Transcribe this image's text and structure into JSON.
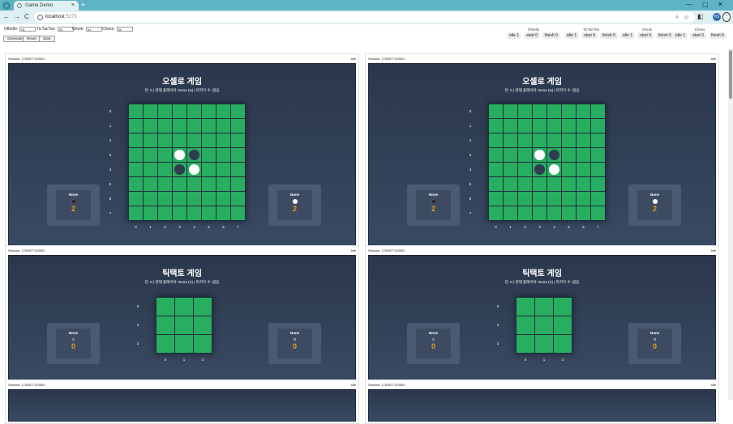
{
  "browser": {
    "tab_title": "Game Demo",
    "url_host": "localhost",
    "url_port": ":5173",
    "new_tab": "+",
    "tab_close": "×",
    "back": "←",
    "forward": "→",
    "reload": "C",
    "zoom_icon": "⌕",
    "star_icon": "☆",
    "menu": "⋮",
    "avatar": "HJ",
    "min": "—",
    "max": "▢",
    "close": "✕",
    "ext1": "◧",
    "ext2": "⇩"
  },
  "controls": {
    "inputs": [
      {
        "label": "Othello:",
        "value": "01"
      },
      {
        "label": "TicTacToe:",
        "value": "01"
      },
      {
        "label": "Omok:",
        "value": "01"
      },
      {
        "label": "Chess:",
        "value": "01"
      }
    ],
    "buttons": [
      "Generate",
      "Reset",
      "Start"
    ]
  },
  "stats": [
    {
      "label": "Othello",
      "chips": [
        "idle 1",
        "start 0",
        "finish 0"
      ]
    },
    {
      "label": "TicTacToe",
      "chips": [
        "idle 1",
        "start 0",
        "finish 0"
      ]
    },
    {
      "label": "Omok",
      "chips": [
        "idle 1",
        "start 0",
        "finish 0"
      ]
    },
    {
      "label": "Chess",
      "chips": [
        "idle 1",
        "start 0",
        "finish 0"
      ]
    }
  ],
  "panels": [
    {
      "session": "Session: 1763877103001",
      "status": "idle",
      "game": "othello",
      "title": "오셀로 게임",
      "info": "턴: 0 | 현재 플레이어: None (w) | 마지막 수: 없음",
      "left": {
        "name": "None",
        "score": "2"
      },
      "right": {
        "name": "None",
        "score": "2"
      }
    },
    {
      "session": "Session: 1763877103001",
      "status": "idle",
      "game": "othello",
      "title": "오셀로 게임",
      "info": "턴: 0 | 현재 플레이어: None (w) | 마지막 수: 없음",
      "left": {
        "name": "None",
        "score": "2"
      },
      "right": {
        "name": "None",
        "score": "2"
      }
    },
    {
      "session": "Session: 1763877103002",
      "status": "idle",
      "game": "ttt",
      "title": "틱택토 게임",
      "info": "턴: 0 | 현재 플레이어: None (X) | 마지막 수: 없음",
      "left": {
        "name": "None",
        "sym": "X",
        "score": "0"
      },
      "right": {
        "name": "None",
        "sym": "O",
        "score": "0"
      }
    },
    {
      "session": "Session: 1763877103002",
      "status": "idle",
      "game": "ttt",
      "title": "틱택토 게임",
      "info": "턴: 0 | 현재 플레이어: None (X) | 마지막 수: 없음",
      "left": {
        "name": "None",
        "sym": "X",
        "score": "0"
      },
      "right": {
        "name": "None",
        "sym": "O",
        "score": "0"
      }
    },
    {
      "session": "Session: 1763877103003",
      "status": "idle",
      "game": "partial"
    },
    {
      "session": "Session: 1763877103003",
      "status": "idle",
      "game": "partial"
    }
  ],
  "othello_board": [
    [
      0,
      0,
      0,
      0,
      0,
      0,
      0,
      0
    ],
    [
      0,
      0,
      0,
      0,
      0,
      0,
      0,
      0
    ],
    [
      0,
      0,
      0,
      0,
      0,
      0,
      0,
      0
    ],
    [
      0,
      0,
      0,
      1,
      2,
      0,
      0,
      0
    ],
    [
      0,
      0,
      0,
      2,
      1,
      0,
      0,
      0
    ],
    [
      0,
      0,
      0,
      0,
      0,
      0,
      0,
      0
    ],
    [
      0,
      0,
      0,
      0,
      0,
      0,
      0,
      0
    ],
    [
      0,
      0,
      0,
      0,
      0,
      0,
      0,
      0
    ]
  ],
  "othello_labels": [
    "0",
    "1",
    "2",
    "3",
    "4",
    "5",
    "6",
    "7"
  ],
  "ttt_labels": [
    "0",
    "1",
    "2"
  ]
}
